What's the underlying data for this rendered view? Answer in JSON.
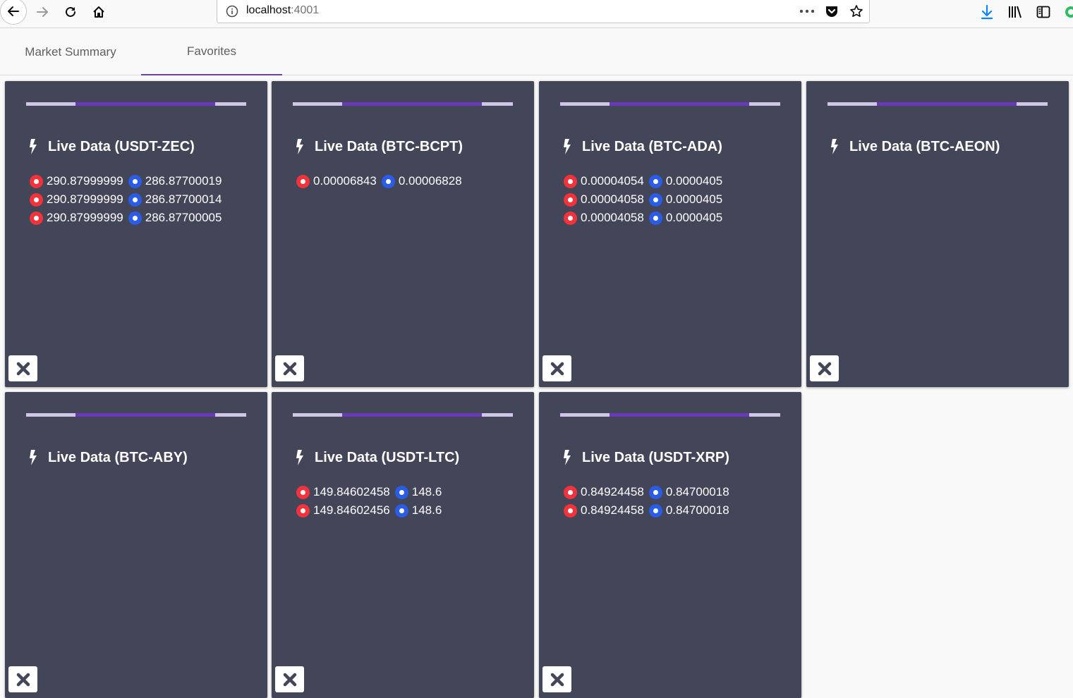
{
  "browser": {
    "url_host": "localhost",
    "url_port": ":4001"
  },
  "tabs": [
    {
      "label": "Market Summary",
      "active": false
    },
    {
      "label": "Favorites",
      "active": true
    }
  ],
  "colors": {
    "card_bg": "#434558",
    "accent": "#673ab7",
    "ask_dot": "#f2333c",
    "bid_dot": "#2a5ce7"
  },
  "cards": [
    {
      "title": "Live Data (USDT-ZEC)",
      "rows": [
        {
          "ask": "290.87999999",
          "bid": "286.87700019"
        },
        {
          "ask": "290.87999999",
          "bid": "286.87700014"
        },
        {
          "ask": "290.87999999",
          "bid": "286.87700005"
        }
      ]
    },
    {
      "title": "Live Data (BTC-BCPT)",
      "rows": [
        {
          "ask": "0.00006843",
          "bid": "0.00006828"
        }
      ]
    },
    {
      "title": "Live Data (BTC-ADA)",
      "rows": [
        {
          "ask": "0.00004054",
          "bid": "0.0000405"
        },
        {
          "ask": "0.00004058",
          "bid": "0.0000405"
        },
        {
          "ask": "0.00004058",
          "bid": "0.0000405"
        }
      ]
    },
    {
      "title": "Live Data (BTC-AEON)",
      "rows": []
    },
    {
      "title": "Live Data (BTC-ABY)",
      "rows": []
    },
    {
      "title": "Live Data (USDT-LTC)",
      "rows": [
        {
          "ask": "149.84602458",
          "bid": "148.6"
        },
        {
          "ask": "149.84602456",
          "bid": "148.6"
        }
      ]
    },
    {
      "title": "Live Data (USDT-XRP)",
      "rows": [
        {
          "ask": "0.84924458",
          "bid": "0.84700018"
        },
        {
          "ask": "0.84924458",
          "bid": "0.84700018"
        }
      ]
    }
  ]
}
